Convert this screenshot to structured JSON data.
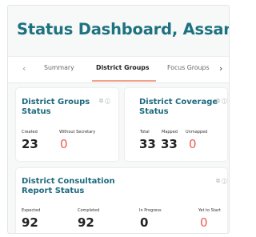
{
  "page_title": "Status Dashboard, Assam",
  "tabs": {
    "prev_arrow": "‹",
    "next_arrow": "›",
    "items": [
      {
        "label": "Summary",
        "active": false
      },
      {
        "label": "District Groups",
        "active": true
      },
      {
        "label": "Focus Groups",
        "active": false
      }
    ]
  },
  "card_icons": "⧉ ⓘ",
  "cards": {
    "district_groups": {
      "title_line1": "District Groups",
      "title_line2": "Status",
      "stats": [
        {
          "label": "Created",
          "value": "23"
        },
        {
          "label": "Without Secretary",
          "value": "0"
        }
      ]
    },
    "district_coverage": {
      "title_line1": "District Coverage",
      "title_line2": "Status",
      "stats": [
        {
          "label": "Total",
          "value": "33"
        },
        {
          "label": "Mapped",
          "value": "33"
        },
        {
          "label": "Unmapped",
          "value": "0"
        }
      ]
    },
    "district_consultation": {
      "title_line1": "District Consultation",
      "title_line2": "Report Status",
      "stats": [
        {
          "label": "Expected",
          "value": "92"
        },
        {
          "label": "Completed",
          "value": "92"
        },
        {
          "label": "In Progress",
          "value": "0"
        },
        {
          "label": "Yet to Start",
          "value": "0"
        }
      ]
    }
  },
  "colors": {
    "accent": "#1d7280",
    "alert": "#ec5d55",
    "tab_underline": "#f1a18a"
  }
}
